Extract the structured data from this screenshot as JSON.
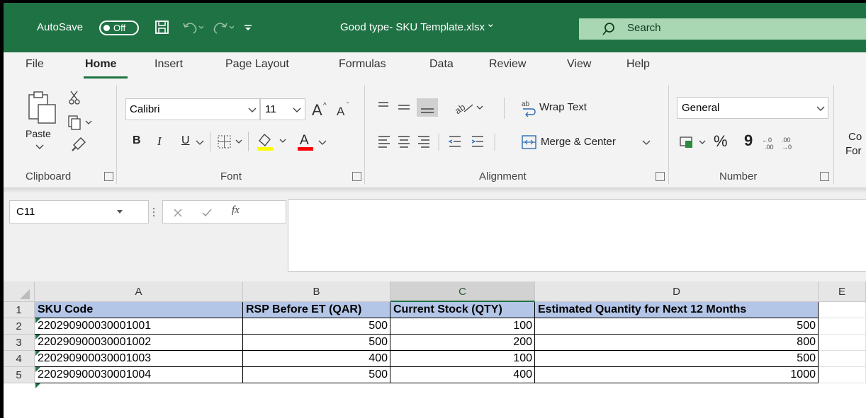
{
  "titlebar": {
    "autosave_label": "AutoSave",
    "autosave_state": "Off",
    "filename": "Good type- SKU Template.xlsx",
    "filename_caret": "⌄",
    "search_label": "Search"
  },
  "tabs": [
    "File",
    "Home",
    "Insert",
    "Page Layout",
    "Formulas",
    "Data",
    "Review",
    "View",
    "Help"
  ],
  "ribbon": {
    "clipboard": {
      "paste_label": "Paste",
      "group_label": "Clipboard"
    },
    "font": {
      "font_name": "Calibri",
      "font_size": "11",
      "bold": "B",
      "italic": "I",
      "underline": "U",
      "font_color_letter": "A",
      "group_label": "Font",
      "font_color": "#ff0000",
      "highlight_color": "#ffff00"
    },
    "alignment": {
      "wrap_text": "Wrap Text",
      "merge_center": "Merge & Center",
      "group_label": "Alignment"
    },
    "number": {
      "format": "General",
      "percent": "%",
      "comma": "9",
      "group_label": "Number"
    },
    "conditional_formatting_partial": [
      "Co",
      "For"
    ]
  },
  "formula_bar": {
    "name_box": "C11",
    "fx_label": "fx",
    "formula": ""
  },
  "columns": [
    "A",
    "B",
    "C",
    "D",
    "E"
  ],
  "selected_column": "C",
  "rows": [
    {
      "num": "1",
      "cells": [
        "SKU Code",
        "RSP Before ET (QAR)",
        "Current Stock (QTY)",
        "Estimated Quantity for Next 12 Months"
      ]
    },
    {
      "num": "2",
      "cells": [
        "220290900030001001",
        "500",
        "100",
        "500"
      ]
    },
    {
      "num": "3",
      "cells": [
        "220290900030001002",
        "500",
        "200",
        "800"
      ]
    },
    {
      "num": "4",
      "cells": [
        "220290900030001003",
        "400",
        "100",
        "500"
      ]
    },
    {
      "num": "5",
      "cells": [
        "220290900030001004",
        "500",
        "400",
        "1000"
      ]
    }
  ],
  "colors": {
    "excel_green": "#1f7244",
    "header_fill": "#b4c6e7",
    "search_fill": "#a9d7b3"
  }
}
